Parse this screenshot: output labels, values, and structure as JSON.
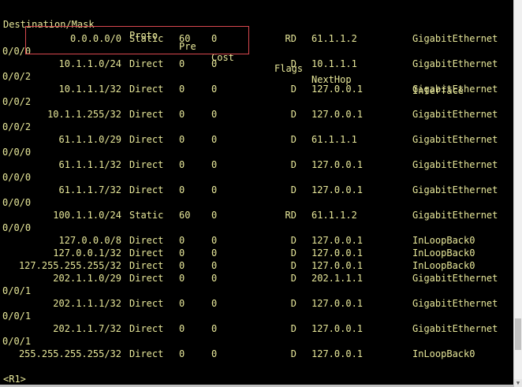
{
  "header": {
    "destination": "Destination/Mask",
    "proto": "Proto",
    "pre": "Pre",
    "cost": "Cost",
    "flags": "Flags",
    "nexthop": "NextHop",
    "interface": "Interface"
  },
  "routes": [
    {
      "destination": "0.0.0.0/0",
      "proto": "Static",
      "pre": "60",
      "cost": "0",
      "flags": "RD",
      "nexthop": "61.1.1.2",
      "interface": "GigabitEthernet",
      "iface_cont": "0/0/0"
    },
    {
      "destination": "10.1.1.0/24",
      "proto": "Direct",
      "pre": "0",
      "cost": "0",
      "flags": "D",
      "nexthop": "10.1.1.1",
      "interface": "GigabitEthernet",
      "iface_cont": "0/0/2"
    },
    {
      "destination": "10.1.1.1/32",
      "proto": "Direct",
      "pre": "0",
      "cost": "0",
      "flags": "D",
      "nexthop": "127.0.0.1",
      "interface": "GigabitEthernet",
      "iface_cont": "0/0/2"
    },
    {
      "destination": "10.1.1.255/32",
      "proto": "Direct",
      "pre": "0",
      "cost": "0",
      "flags": "D",
      "nexthop": "127.0.0.1",
      "interface": "GigabitEthernet",
      "iface_cont": "0/0/2"
    },
    {
      "destination": "61.1.1.0/29",
      "proto": "Direct",
      "pre": "0",
      "cost": "0",
      "flags": "D",
      "nexthop": "61.1.1.1",
      "interface": "GigabitEthernet",
      "iface_cont": "0/0/0"
    },
    {
      "destination": "61.1.1.1/32",
      "proto": "Direct",
      "pre": "0",
      "cost": "0",
      "flags": "D",
      "nexthop": "127.0.0.1",
      "interface": "GigabitEthernet",
      "iface_cont": "0/0/0"
    },
    {
      "destination": "61.1.1.7/32",
      "proto": "Direct",
      "pre": "0",
      "cost": "0",
      "flags": "D",
      "nexthop": "127.0.0.1",
      "interface": "GigabitEthernet",
      "iface_cont": "0/0/0"
    },
    {
      "destination": "100.1.1.0/24",
      "proto": "Static",
      "pre": "60",
      "cost": "0",
      "flags": "RD",
      "nexthop": "61.1.1.2",
      "interface": "GigabitEthernet",
      "iface_cont": "0/0/0"
    },
    {
      "destination": "127.0.0.0/8",
      "proto": "Direct",
      "pre": "0",
      "cost": "0",
      "flags": "D",
      "nexthop": "127.0.0.1",
      "interface": "InLoopBack0",
      "iface_cont": ""
    },
    {
      "destination": "127.0.0.1/32",
      "proto": "Direct",
      "pre": "0",
      "cost": "0",
      "flags": "D",
      "nexthop": "127.0.0.1",
      "interface": "InLoopBack0",
      "iface_cont": ""
    },
    {
      "destination": "127.255.255.255/32",
      "proto": "Direct",
      "pre": "0",
      "cost": "0",
      "flags": "D",
      "nexthop": "127.0.0.1",
      "interface": "InLoopBack0",
      "iface_cont": ""
    },
    {
      "destination": "202.1.1.0/29",
      "proto": "Direct",
      "pre": "0",
      "cost": "0",
      "flags": "D",
      "nexthop": "202.1.1.1",
      "interface": "GigabitEthernet",
      "iface_cont": "0/0/1"
    },
    {
      "destination": "202.1.1.1/32",
      "proto": "Direct",
      "pre": "0",
      "cost": "0",
      "flags": "D",
      "nexthop": "127.0.0.1",
      "interface": "GigabitEthernet",
      "iface_cont": "0/0/1"
    },
    {
      "destination": "202.1.1.7/32",
      "proto": "Direct",
      "pre": "0",
      "cost": "0",
      "flags": "D",
      "nexthop": "127.0.0.1",
      "interface": "GigabitEthernet",
      "iface_cont": "0/0/1"
    },
    {
      "destination": "255.255.255.255/32",
      "proto": "Direct",
      "pre": "0",
      "cost": "0",
      "flags": "D",
      "nexthop": "127.0.0.1",
      "interface": "InLoopBack0",
      "iface_cont": ""
    }
  ],
  "prompt": "<R1>",
  "colors": {
    "text": "#e8e89a",
    "background": "#000000",
    "highlight": "#d9484f"
  }
}
